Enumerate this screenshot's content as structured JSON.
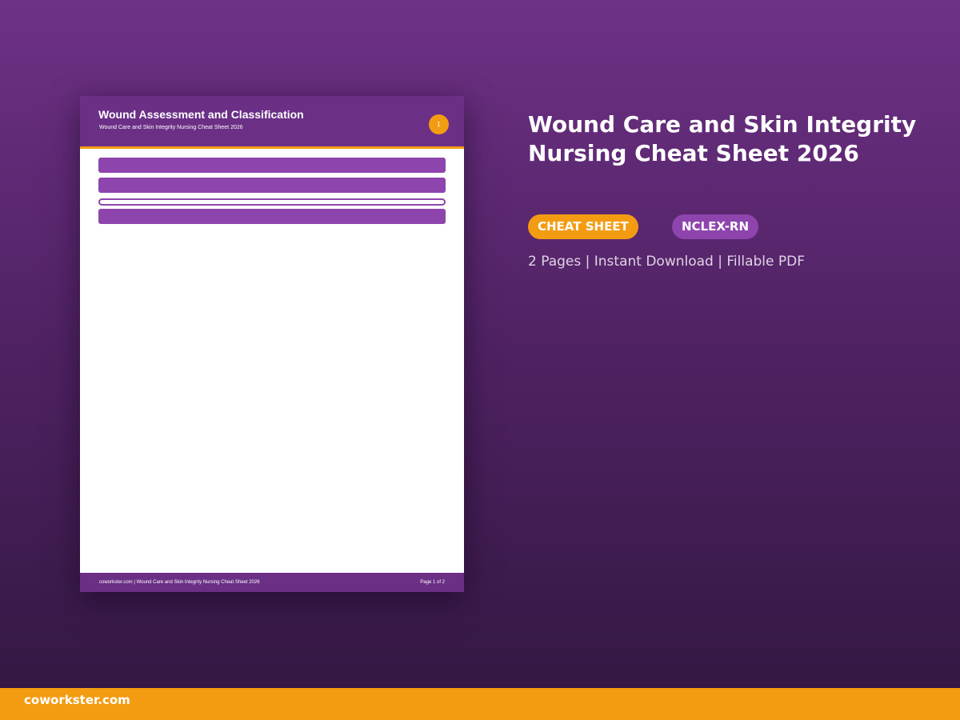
{
  "document_preview": {
    "title": "Wound Assessment and Classification",
    "subtitle": "Wound Care and Skin Integrity Nursing Cheat Sheet 2026",
    "page_badge": "1",
    "footer_left": "coworkster.com | Wound Care and Skin Integrity Nursing Cheat Sheet 2026",
    "footer_right": "Page 1 of 2"
  },
  "product": {
    "title": "Wound Care and Skin Integrity Nursing Cheat Sheet 2026",
    "tags": [
      "CHEAT SHEET",
      "NCLEX-RN"
    ],
    "meta": "2 Pages | Instant Download | Fillable PDF"
  },
  "brand": {
    "site": "coworkster.com"
  },
  "colors": {
    "header_purple": "#6b2f86",
    "accent_orange": "#f39c12",
    "bar_purple": "#8e44ad",
    "background_top": "#6e3185",
    "background_bottom": "#321740"
  }
}
